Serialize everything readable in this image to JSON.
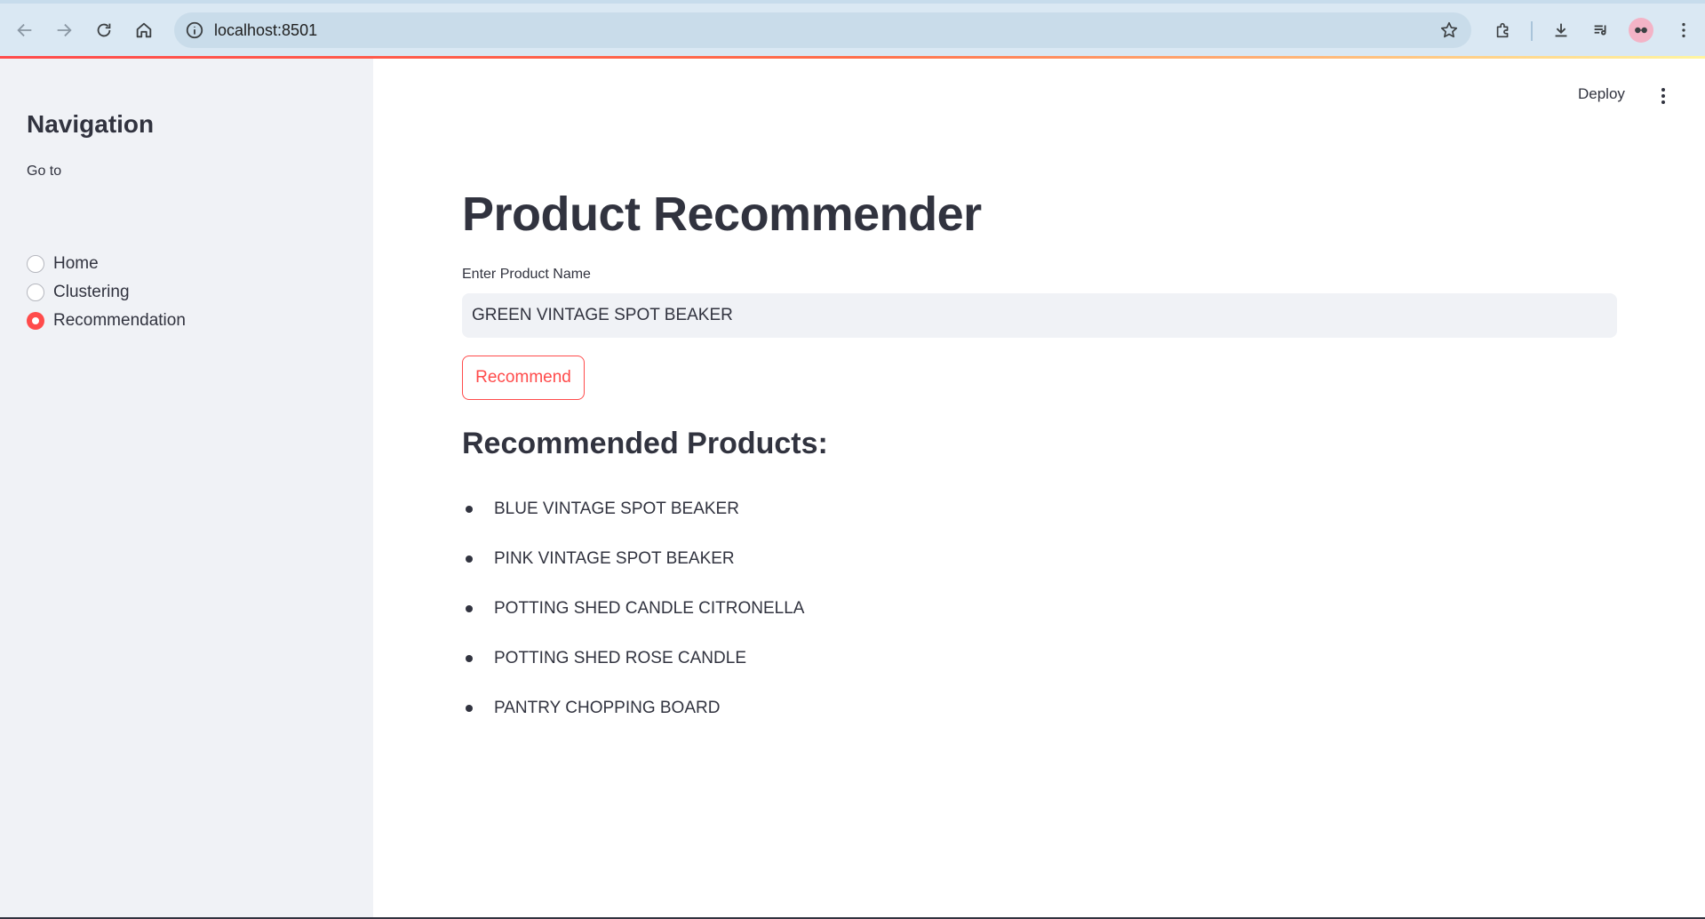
{
  "browser": {
    "url": "localhost:8501"
  },
  "header": {
    "deploy_label": "Deploy"
  },
  "sidebar": {
    "title": "Navigation",
    "radio_label": "Go to",
    "options": [
      {
        "label": "Home",
        "checked": false
      },
      {
        "label": "Clustering",
        "checked": false
      },
      {
        "label": "Recommendation",
        "checked": true
      }
    ]
  },
  "main": {
    "title": "Product Recommender",
    "input_label": "Enter Product Name",
    "input_value": "GREEN VINTAGE SPOT BEAKER",
    "button_label": "Recommend",
    "results_heading": "Recommended Products:",
    "results": [
      "BLUE VINTAGE SPOT BEAKER",
      "PINK VINTAGE SPOT BEAKER",
      "POTTING SHED CANDLE CITRONELLA",
      "POTTING SHED ROSE CANDLE",
      "PANTRY CHOPPING BOARD"
    ]
  },
  "colors": {
    "accent": "#ff4b4b",
    "sidebar_bg": "#f0f2f6",
    "text": "#31333f"
  }
}
